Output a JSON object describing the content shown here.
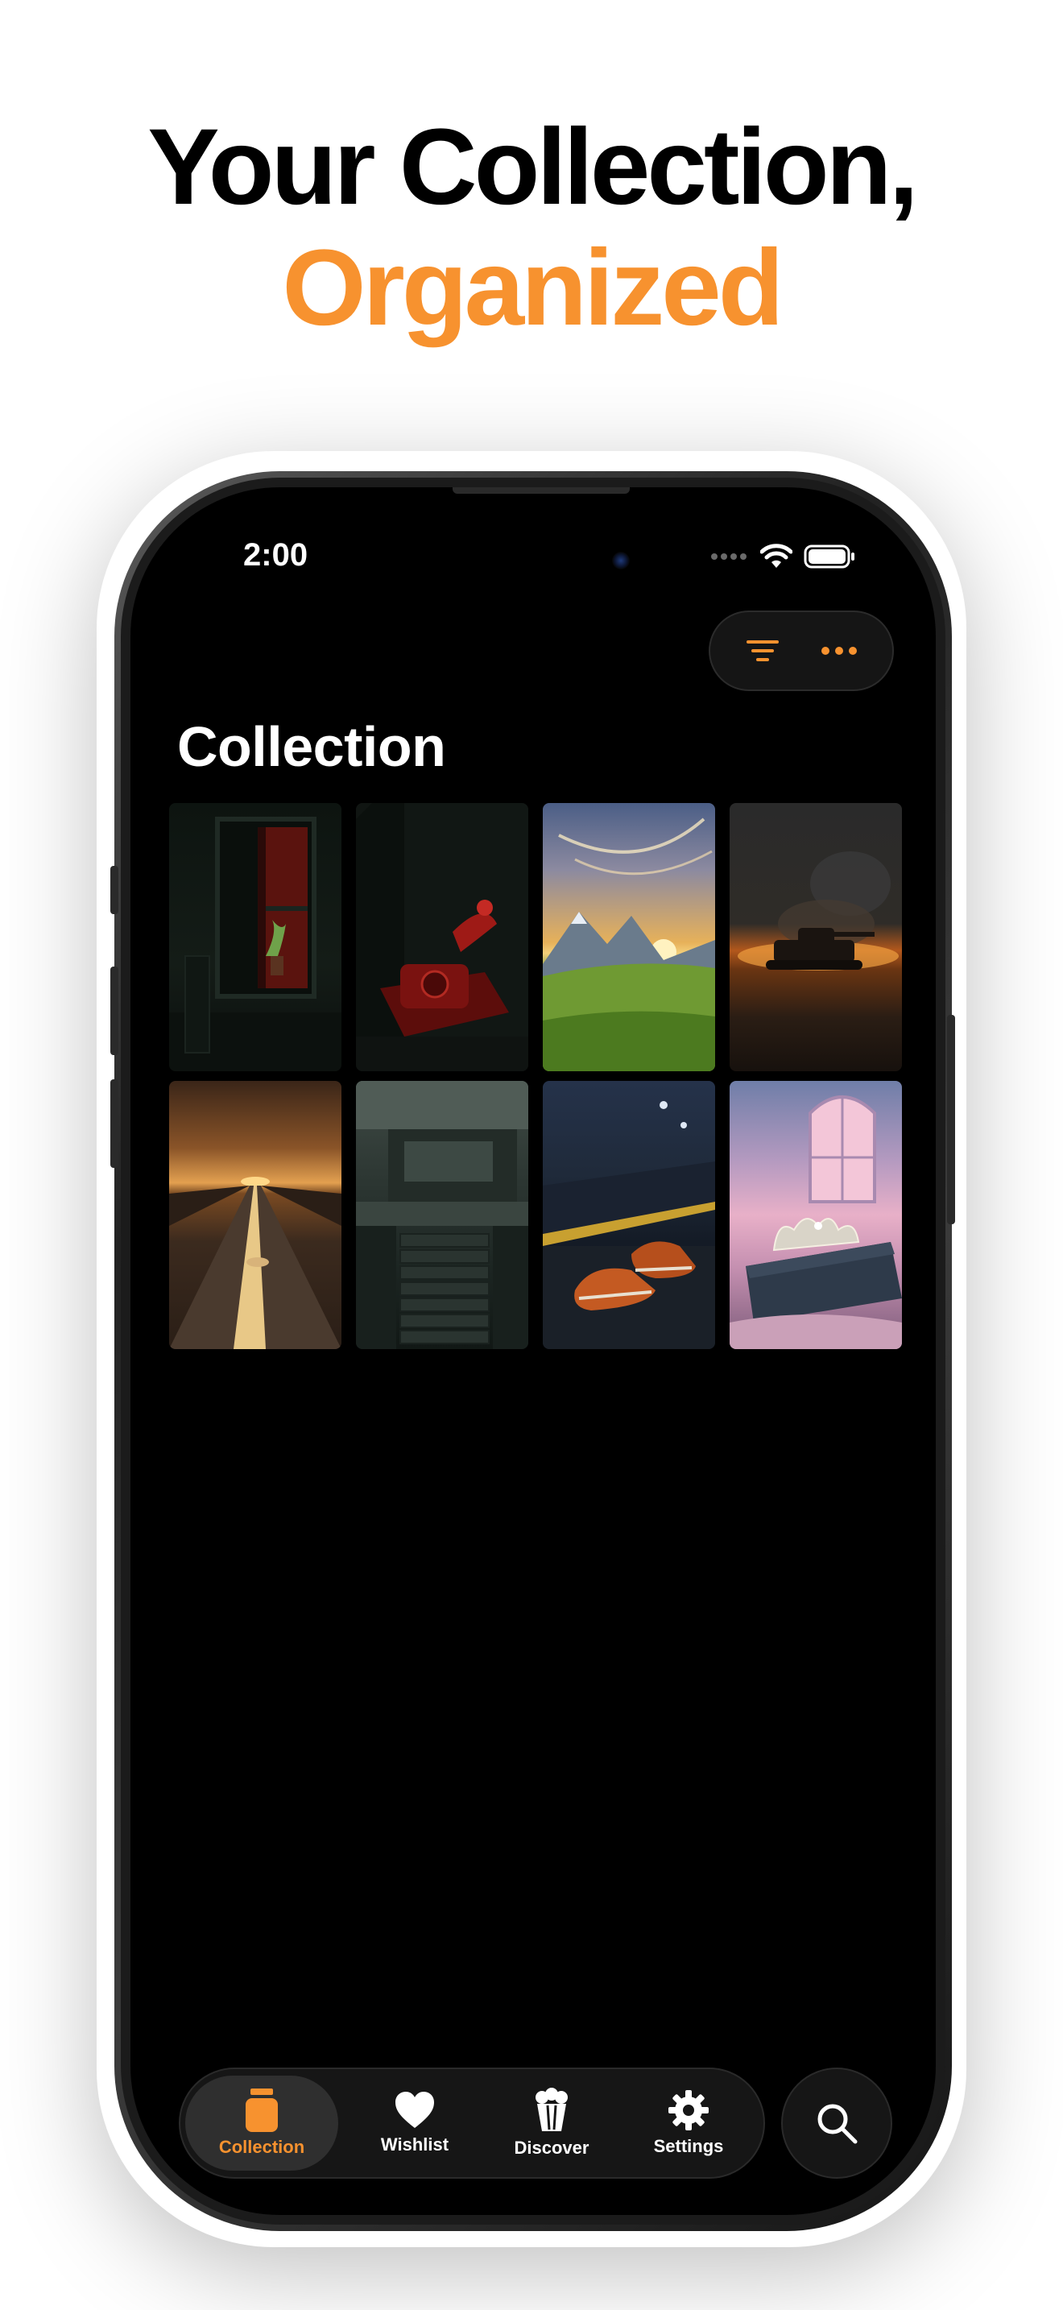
{
  "headline": {
    "line1": "Your Collection,",
    "line2": "Organized",
    "accent_color": "#f7922f"
  },
  "status_bar": {
    "time": "2:00",
    "icons": [
      "signal-dots-icon",
      "wifi-icon",
      "battery-icon"
    ]
  },
  "toolbar": {
    "filter_icon": "filter-lines-icon",
    "more_icon": "ellipsis-icon"
  },
  "page": {
    "title": "Collection"
  },
  "collection": {
    "items": [
      {
        "subject": "dark window with red curtain and plant"
      },
      {
        "subject": "red rotary telephone in dark hallway"
      },
      {
        "subject": "sunset over mountain meadow"
      },
      {
        "subject": "tank on battlefield with smoke"
      },
      {
        "subject": "desert road at sunset"
      },
      {
        "subject": "modern concrete building with stairs"
      },
      {
        "subject": "orange sneakers on rainy train platform"
      },
      {
        "subject": "tiara on book by pink window"
      }
    ]
  },
  "tabbar": {
    "tabs": [
      {
        "label": "Collection",
        "icon": "jar-icon",
        "active": true
      },
      {
        "label": "Wishlist",
        "icon": "heart-icon",
        "active": false
      },
      {
        "label": "Discover",
        "icon": "popcorn-icon",
        "active": false
      },
      {
        "label": "Settings",
        "icon": "gear-icon",
        "active": false
      }
    ],
    "search_icon": "search-icon"
  }
}
